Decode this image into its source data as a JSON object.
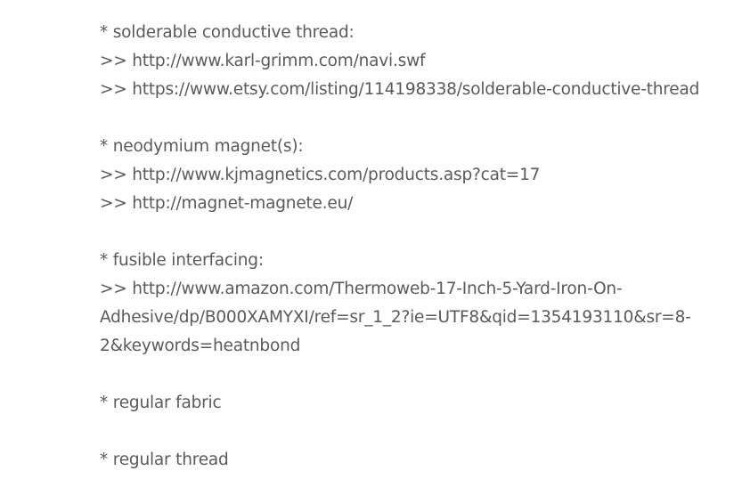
{
  "items": [
    {
      "heading": "* solderable conductive thread:",
      "links": [
        ">> http://www.karl-grimm.com/navi.swf",
        ">> https://www.etsy.com/listing/114198338/solderable-conductive-thread"
      ]
    },
    {
      "heading": "* neodymium magnet(s):",
      "links": [
        ">> http://www.kjmagnetics.com/products.asp?cat=17",
        ">> http://magnet-magnete.eu/"
      ]
    },
    {
      "heading": "* fusible interfacing:",
      "links": [
        ">> http://www.amazon.com/Thermoweb-17-Inch-5-Yard-Iron-On-",
        "Adhesive/dp/B000XAMYXI/ref=sr_1_2?ie=UTF8&qid=1354193110&sr=8-",
        "2&keywords=heatnbond"
      ]
    },
    {
      "heading": "* regular fabric",
      "links": []
    },
    {
      "heading": "* regular thread",
      "links": []
    }
  ]
}
